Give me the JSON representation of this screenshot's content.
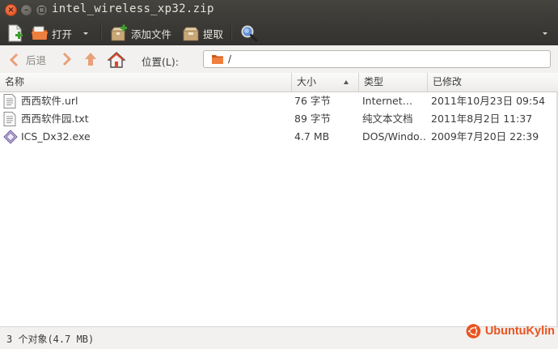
{
  "window": {
    "title": "intel_wireless_xp32.zip"
  },
  "toolbar": {
    "new_icon": "new-archive-icon",
    "open_label": "打开",
    "add_files_label": "添加文件",
    "extract_label": "提取"
  },
  "nav": {
    "back_label": "后退",
    "location_label": "位置(L):",
    "location_value": "/"
  },
  "columns": {
    "name": "名称",
    "size": "大小",
    "type": "类型",
    "modified": "已修改"
  },
  "files": [
    {
      "name": "西西软件.url",
      "size": "76 字节",
      "type": "Internet…",
      "modified": "2011年10月23日 09:54",
      "icon": "text-file-icon"
    },
    {
      "name": "西西软件园.txt",
      "size": "89 字节",
      "type": "纯文本文档",
      "modified": "2011年8月2日 11:37",
      "icon": "text-file-icon"
    },
    {
      "name": "ICS_Dx32.exe",
      "size": "4.7 MB",
      "type": "DOS/Windo…",
      "modified": "2009年7月20日 22:39",
      "icon": "executable-icon"
    }
  ],
  "status": {
    "text": "3 个对象(4.7 MB)"
  },
  "brand": {
    "name": "UbuntuKylin"
  },
  "colors": {
    "accent": "#e95420",
    "titlebar": "#3c3b37",
    "folder": "#e8762d"
  }
}
